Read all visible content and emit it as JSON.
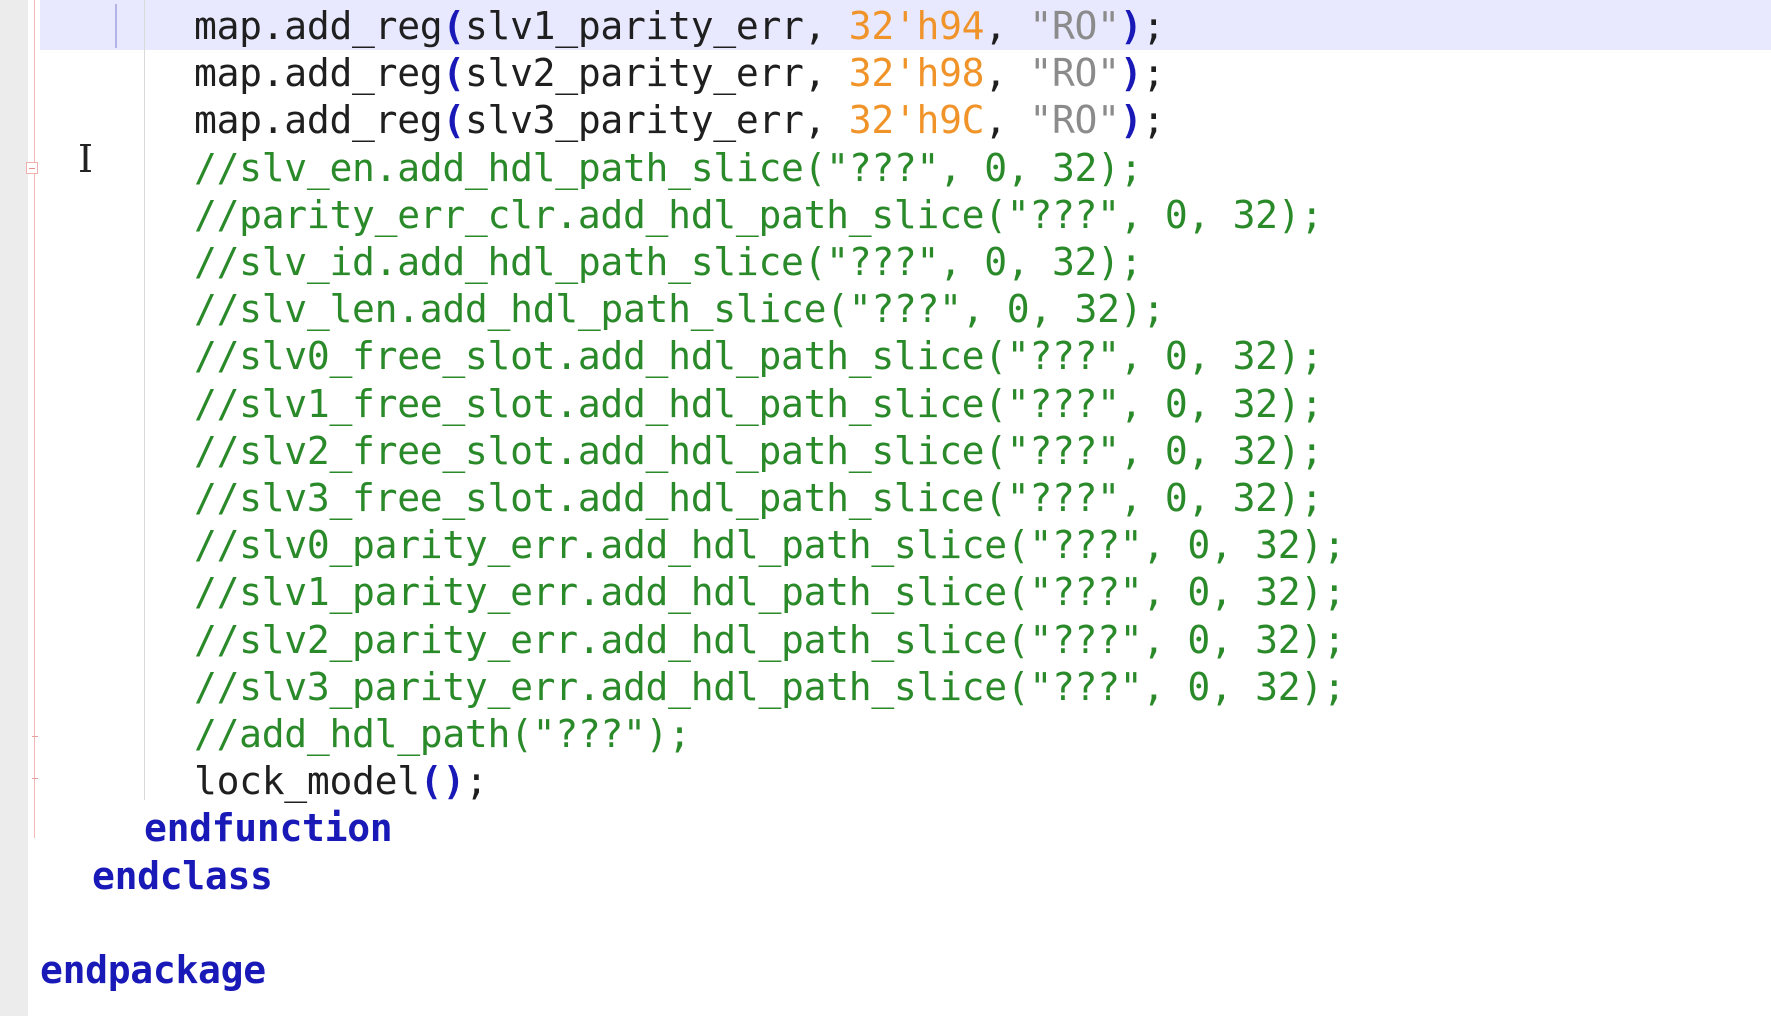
{
  "editor": {
    "lines": [
      {
        "parts": [
          {
            "t": "map.add_reg",
            "c": "plain"
          },
          {
            "t": "(",
            "c": "paren"
          },
          {
            "t": "slv1_parity_err, ",
            "c": "plain"
          },
          {
            "t": "32'h94",
            "c": "num"
          },
          {
            "t": ", ",
            "c": "plain"
          },
          {
            "t": "\"RO\"",
            "c": "str"
          },
          {
            "t": ")",
            "c": "paren"
          },
          {
            "t": ";",
            "c": "plain"
          }
        ]
      },
      {
        "parts": [
          {
            "t": "map.add_reg",
            "c": "plain"
          },
          {
            "t": "(",
            "c": "paren"
          },
          {
            "t": "slv2_parity_err, ",
            "c": "plain"
          },
          {
            "t": "32'h98",
            "c": "num"
          },
          {
            "t": ", ",
            "c": "plain"
          },
          {
            "t": "\"RO\"",
            "c": "str"
          },
          {
            "t": ")",
            "c": "paren"
          },
          {
            "t": ";",
            "c": "plain"
          }
        ]
      },
      {
        "parts": [
          {
            "t": "map.add_reg",
            "c": "plain"
          },
          {
            "t": "(",
            "c": "paren"
          },
          {
            "t": "slv3_parity_err, ",
            "c": "plain"
          },
          {
            "t": "32'h9C",
            "c": "num"
          },
          {
            "t": ", ",
            "c": "plain"
          },
          {
            "t": "\"RO\"",
            "c": "str"
          },
          {
            "t": ")",
            "c": "paren"
          },
          {
            "t": ";",
            "c": "plain"
          }
        ]
      },
      {
        "parts": [
          {
            "t": "//slv_en.add_hdl_path_slice(\"???\", 0, 32);",
            "c": "comment"
          }
        ]
      },
      {
        "parts": [
          {
            "t": "//parity_err_clr.add_hdl_path_slice(\"???\", 0, 32);",
            "c": "comment"
          }
        ]
      },
      {
        "parts": [
          {
            "t": "//slv_id.add_hdl_path_slice(\"???\", 0, 32);",
            "c": "comment"
          }
        ]
      },
      {
        "parts": [
          {
            "t": "//slv_len.add_hdl_path_slice(\"???\", 0, 32);",
            "c": "comment"
          }
        ]
      },
      {
        "parts": [
          {
            "t": "//slv0_free_slot.add_hdl_path_slice(\"???\", 0, 32);",
            "c": "comment"
          }
        ]
      },
      {
        "parts": [
          {
            "t": "//slv1_free_slot.add_hdl_path_slice(\"???\", 0, 32);",
            "c": "comment"
          }
        ]
      },
      {
        "parts": [
          {
            "t": "//slv2_free_slot.add_hdl_path_slice(\"???\", 0, 32);",
            "c": "comment"
          }
        ]
      },
      {
        "parts": [
          {
            "t": "//slv3_free_slot.add_hdl_path_slice(\"???\", 0, 32);",
            "c": "comment"
          }
        ]
      },
      {
        "parts": [
          {
            "t": "//slv0_parity_err.add_hdl_path_slice(\"???\", 0, 32);",
            "c": "comment"
          }
        ]
      },
      {
        "parts": [
          {
            "t": "//slv1_parity_err.add_hdl_path_slice(\"???\", 0, 32);",
            "c": "comment"
          }
        ]
      },
      {
        "parts": [
          {
            "t": "//slv2_parity_err.add_hdl_path_slice(\"???\", 0, 32);",
            "c": "comment"
          }
        ]
      },
      {
        "parts": [
          {
            "t": "//slv3_parity_err.add_hdl_path_slice(\"???\", 0, 32);",
            "c": "comment"
          }
        ]
      },
      {
        "parts": [
          {
            "t": "//add_hdl_path(\"???\");",
            "c": "comment"
          }
        ]
      },
      {
        "parts": [
          {
            "t": "lock_model",
            "c": "plain"
          },
          {
            "t": "()",
            "c": "paren"
          },
          {
            "t": ";",
            "c": "plain"
          }
        ]
      },
      {
        "parts": [
          {
            "t": "endfunction",
            "c": "keyword"
          }
        ]
      },
      {
        "parts": [
          {
            "t": "endclass",
            "c": "keyword"
          }
        ]
      },
      {
        "parts": [
          {
            "t": "",
            "c": "plain"
          }
        ]
      },
      {
        "parts": [
          {
            "t": "endpackage",
            "c": "keyword"
          }
        ]
      }
    ],
    "colors": {
      "keyword": "#1919b8",
      "number": "#f0942a",
      "string": "#8b8b8b",
      "comment": "#2a8a2a",
      "current_line_bg": "#e8e8ff"
    }
  }
}
